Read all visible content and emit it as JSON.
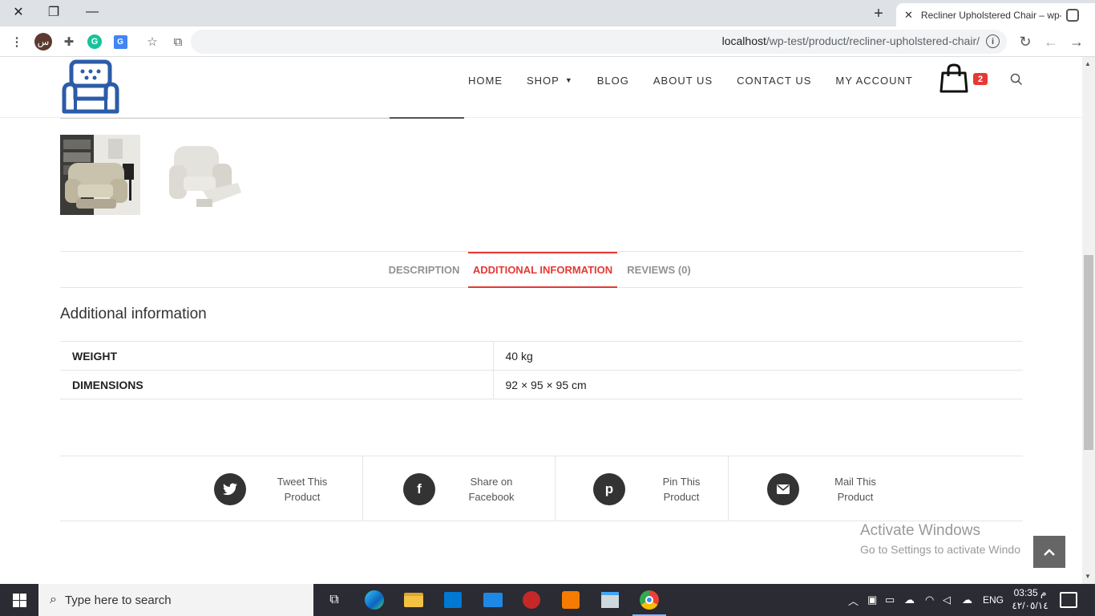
{
  "browser": {
    "tab_title": "Recliner Upholstered Chair – wp-",
    "url_host": "localhost",
    "url_path": "/wp-test/product/recliner-upholstered-chair/",
    "profile_glyph": "س"
  },
  "nav": {
    "items": [
      "HOME",
      "SHOP",
      "BLOG",
      "ABOUT US",
      "CONTACT US",
      "MY ACCOUNT"
    ],
    "cart_count": "2"
  },
  "product_tabs": {
    "items": [
      "DESCRIPTION",
      "ADDITIONAL INFORMATION",
      "REVIEWS (0)"
    ],
    "active": "ADDITIONAL INFORMATION"
  },
  "additional_info": {
    "title": "Additional information",
    "rows": [
      {
        "label": "WEIGHT",
        "value": "40 kg"
      },
      {
        "label": "DIMENSIONS",
        "value": "92 × 95 × 95 cm"
      }
    ]
  },
  "share": {
    "items": [
      {
        "label": "Tweet This Product",
        "icon": "twitter-icon"
      },
      {
        "label": "Share on Facebook",
        "icon": "facebook-icon"
      },
      {
        "label": "Pin This Product",
        "icon": "pinterest-icon"
      },
      {
        "label": "Mail This Product",
        "icon": "mail-icon"
      }
    ]
  },
  "watermark": {
    "line1": "Activate Windows",
    "line2": "Go to Settings to activate Windo"
  },
  "taskbar": {
    "search_placeholder": "Type here to search",
    "language": "ENG",
    "time": "03:35 م",
    "date": "٤٢/٠٥/١٤"
  },
  "colors": {
    "accent": "#e53935",
    "logo_blue": "#2b5ca8"
  }
}
